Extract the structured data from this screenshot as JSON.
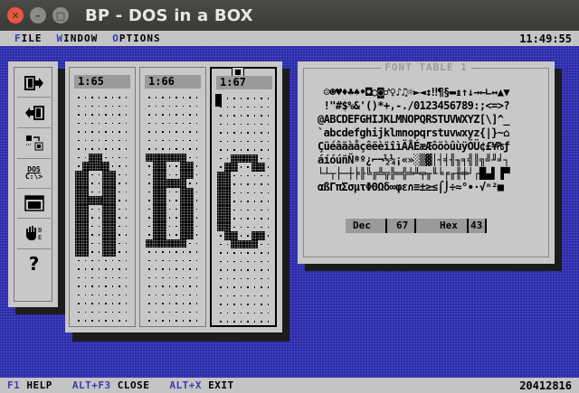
{
  "window": {
    "title": "BP - DOS in a BOX",
    "controls": {
      "close_icon": "close-icon",
      "min_icon": "minimize-icon",
      "max_icon": "maximize-icon"
    }
  },
  "menubar": {
    "items": [
      {
        "hot": "F",
        "rest": "ILE"
      },
      {
        "hot": "W",
        "rest": "INDOW"
      },
      {
        "hot": "O",
        "rest": "PTIONS"
      }
    ],
    "clock": "11:49:55"
  },
  "tools": [
    "exit-door-icon",
    "enter-door-icon",
    "convert-icon",
    "dos-prompt-icon",
    "window-icon",
    "hand-icon",
    "help-icon"
  ],
  "tool_text": {
    "dos_top": "DOS",
    "dos_bottom": "C:\\>",
    "help": "?"
  },
  "glyphs": [
    {
      "label": "1:65",
      "char": "A"
    },
    {
      "label": "1:66",
      "char": "B"
    },
    {
      "label": "1:67",
      "char": "C"
    }
  ],
  "font_table": {
    "title": "FONT TABLE 1",
    "rows": [
      " ☺☻♥♦♣♠•◘○◙♂♀♪♫☼►◄↕‼¶§▬↨↑↓→←∟↔▲▼",
      " !\"#$%&'()*+,-./0123456789:;<=>?",
      "@ABCDEFGHIJKLMNOPQRSTUVWXYZ[\\]^_",
      "`abcdefghijklmnopqrstuvwxyz{|}~⌂",
      "ÇüéâäàåçêëèïîìÄÅÉæÆôöòûùÿÖÜ¢£¥₧ƒ",
      "áíóúñÑªº¿⌐¬½¼¡«»░▒▓│┤╡╢╖╕╣║╗╝╜╛┐",
      "└┴┬├─┼╞╟╚╔╩╦╠═╬╧╨╤╥╙╘╒╓╫╪┘┌█▄▌▐▀",
      "αßΓπΣσµτΦΘΩδ∞φε∩≡±≥≤⌠⌡÷≈°∙·√ⁿ²■ "
    ],
    "dec_label": "Dec",
    "dec_value": "67",
    "hex_label": "Hex",
    "hex_value": "43"
  },
  "statusbar": {
    "items": [
      {
        "key": "F1",
        "label": "HELP"
      },
      {
        "key": "ALT+F3",
        "label": "CLOSE"
      },
      {
        "key": "ALT+X",
        "label": "EXIT"
      }
    ],
    "number": "20412816"
  }
}
